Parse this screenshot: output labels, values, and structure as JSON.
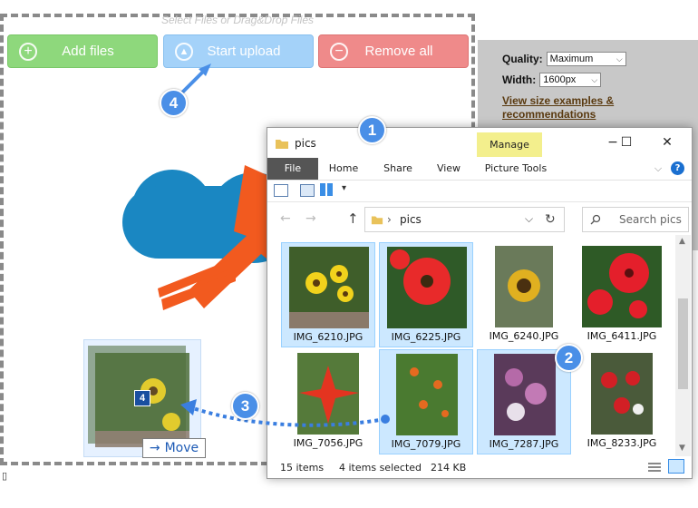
{
  "uploader": {
    "drop_hint": "Select Files or Drag&Drop Files",
    "add_label": "Add files",
    "start_label": "Start upload",
    "remove_label": "Remove all"
  },
  "options": {
    "quality_label": "Quality:",
    "quality_value": "Maximum",
    "width_label": "Width:",
    "width_value": "1600px",
    "link_text": "View size examples & recommendations"
  },
  "callouts": [
    "1",
    "2",
    "3",
    "4"
  ],
  "explorer": {
    "title": "pics",
    "manage_tab": "Manage",
    "ribbon_tabs": [
      "File",
      "Home",
      "Share",
      "View",
      "Picture Tools"
    ],
    "address_folder": "pics",
    "search_placeholder": "Search pics",
    "files": [
      {
        "name": "IMG_6210.JPG",
        "selected": true
      },
      {
        "name": "IMG_6225.JPG",
        "selected": true
      },
      {
        "name": "IMG_6240.JPG",
        "selected": false
      },
      {
        "name": "IMG_6411.JPG",
        "selected": false
      },
      {
        "name": "IMG_7056.JPG",
        "selected": false
      },
      {
        "name": "IMG_7079.JPG",
        "selected": true
      },
      {
        "name": "IMG_7287.JPG",
        "selected": true
      },
      {
        "name": "IMG_8233.JPG",
        "selected": false
      }
    ],
    "status_items": "15 items",
    "status_selected": "4 items selected",
    "status_size": "214 KB"
  },
  "drag": {
    "count_badge": "4",
    "move_label": "Move"
  },
  "footer_glyph": "▯",
  "colors": {
    "add_button": "#8ed87c",
    "start_button": "#a4d2f9",
    "remove_button": "#ef8a8a",
    "callout_blue": "#4a8fe7",
    "cloud_blue": "#1a87c2",
    "arrow_orange": "#f25a1f",
    "manage_yellow": "#f3ef8d",
    "selection_blue": "#cce8ff"
  },
  "icons": [
    "plus-circle-icon",
    "upload-arrow-icon",
    "minus-circle-icon",
    "folder-icon",
    "search-icon",
    "refresh-icon",
    "help-icon"
  ]
}
